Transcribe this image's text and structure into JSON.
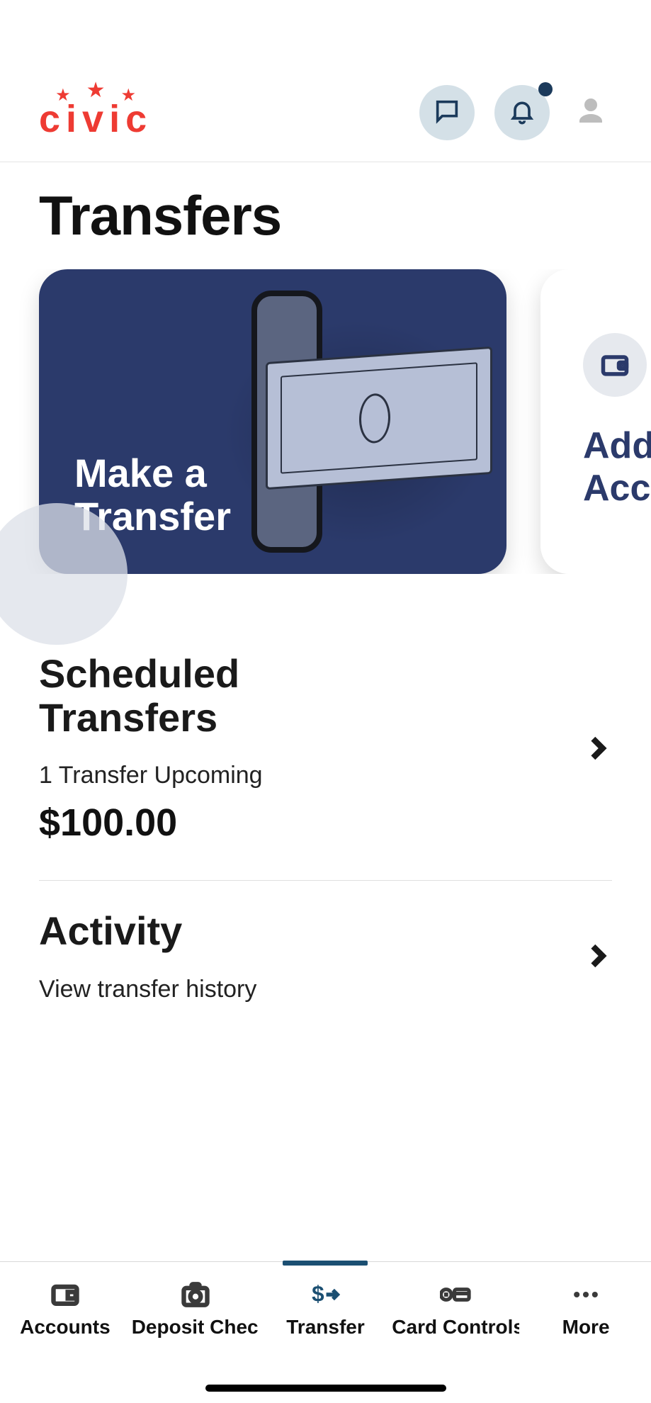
{
  "brand": {
    "name": "civic"
  },
  "header": {
    "notification_dot": true
  },
  "page": {
    "title": "Transfers"
  },
  "cards": {
    "make_transfer": {
      "title": "Make a\nTransfer"
    },
    "add_account": {
      "title": "Add\nAccount"
    }
  },
  "scheduled": {
    "title": "Scheduled Transfers",
    "subtitle": "1 Transfer Upcoming",
    "amount": "$100.00"
  },
  "activity": {
    "title": "Activity",
    "subtitle": "View transfer history"
  },
  "tabs": {
    "accounts": "Accounts",
    "deposit": "Deposit Check",
    "transfer": "Transfer",
    "card_controls": "Card Controls",
    "more": "More"
  },
  "colors": {
    "brand_red": "#ee3b33",
    "card_navy": "#2b3a6b",
    "accent": "#1b4f72"
  }
}
